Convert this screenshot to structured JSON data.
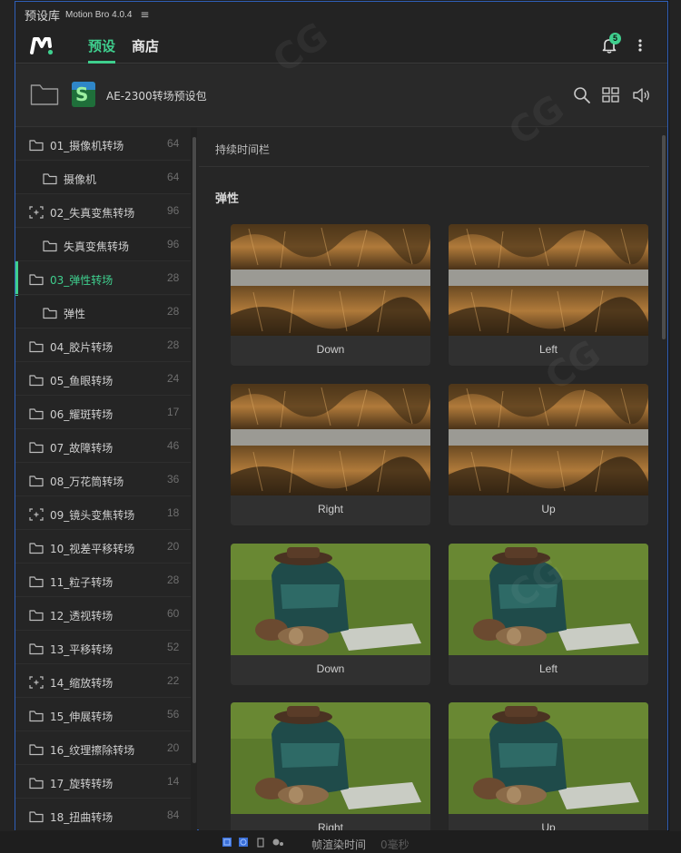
{
  "panel": {
    "title": "预设库",
    "subtitle": "Motion Bro 4.0.4",
    "menu_glyph": "≡"
  },
  "header": {
    "logo_icon": "motion-bro-logo-icon",
    "tabs": [
      {
        "label": "预设",
        "active": true
      },
      {
        "label": "商店",
        "active": false
      }
    ],
    "notification_count": "5",
    "accent": "#3fcf8e"
  },
  "pack": {
    "name": "AE-2300转场预设包"
  },
  "sidebar": {
    "items": [
      {
        "label": "01_摄像机转场",
        "count": "64",
        "icon": "folder-icon",
        "sub": false,
        "active": false
      },
      {
        "label": "摄像机",
        "count": "64",
        "icon": "folder-icon",
        "sub": true,
        "active": false
      },
      {
        "label": "02_失真变焦转场",
        "count": "96",
        "icon": "focus-frame-icon",
        "sub": false,
        "active": false
      },
      {
        "label": "失真变焦转场",
        "count": "96",
        "icon": "folder-icon",
        "sub": true,
        "active": false
      },
      {
        "label": "03_弹性转场",
        "count": "28",
        "icon": "folder-icon",
        "sub": false,
        "active": true
      },
      {
        "label": "弹性",
        "count": "28",
        "icon": "folder-icon",
        "sub": true,
        "active": false
      },
      {
        "label": "04_胶片转场",
        "count": "28",
        "icon": "folder-icon",
        "sub": false,
        "active": false
      },
      {
        "label": "05_鱼眼转场",
        "count": "24",
        "icon": "folder-icon",
        "sub": false,
        "active": false
      },
      {
        "label": "06_耀斑转场",
        "count": "17",
        "icon": "folder-icon",
        "sub": false,
        "active": false
      },
      {
        "label": "07_故障转场",
        "count": "46",
        "icon": "folder-icon",
        "sub": false,
        "active": false
      },
      {
        "label": "08_万花筒转场",
        "count": "36",
        "icon": "folder-icon",
        "sub": false,
        "active": false
      },
      {
        "label": "09_镜头变焦转场",
        "count": "18",
        "icon": "focus-frame-icon",
        "sub": false,
        "active": false
      },
      {
        "label": "10_视差平移转场",
        "count": "20",
        "icon": "folder-icon",
        "sub": false,
        "active": false
      },
      {
        "label": "11_粒子转场",
        "count": "28",
        "icon": "folder-icon",
        "sub": false,
        "active": false
      },
      {
        "label": "12_透视转场",
        "count": "60",
        "icon": "folder-icon",
        "sub": false,
        "active": false
      },
      {
        "label": "13_平移转场",
        "count": "52",
        "icon": "folder-icon",
        "sub": false,
        "active": false
      },
      {
        "label": "14_缩放转场",
        "count": "22",
        "icon": "focus-frame-icon",
        "sub": false,
        "active": false
      },
      {
        "label": "15_伸展转场",
        "count": "56",
        "icon": "folder-icon",
        "sub": false,
        "active": false
      },
      {
        "label": "16_纹理擦除转场",
        "count": "20",
        "icon": "folder-icon",
        "sub": false,
        "active": false
      },
      {
        "label": "17_旋转转场",
        "count": "14",
        "icon": "folder-icon",
        "sub": false,
        "active": false
      },
      {
        "label": "18_扭曲转场",
        "count": "84",
        "icon": "folder-icon",
        "sub": false,
        "active": false
      }
    ]
  },
  "content": {
    "duration_label": "持续时间栏",
    "section_title": "弹性",
    "cards": [
      {
        "label": "Down",
        "thumb": "dog"
      },
      {
        "label": "Left",
        "thumb": "dog"
      },
      {
        "label": "Right",
        "thumb": "dog"
      },
      {
        "label": "Up",
        "thumb": "dog"
      },
      {
        "label": "Down",
        "thumb": "backpack"
      },
      {
        "label": "Left",
        "thumb": "backpack"
      },
      {
        "label": "Right",
        "thumb": "backpack"
      },
      {
        "label": "Up",
        "thumb": "backpack"
      }
    ]
  },
  "footer": {
    "render_time_label": "帧渲染时间",
    "render_time_value": "0毫秒"
  },
  "watermark": "CG"
}
